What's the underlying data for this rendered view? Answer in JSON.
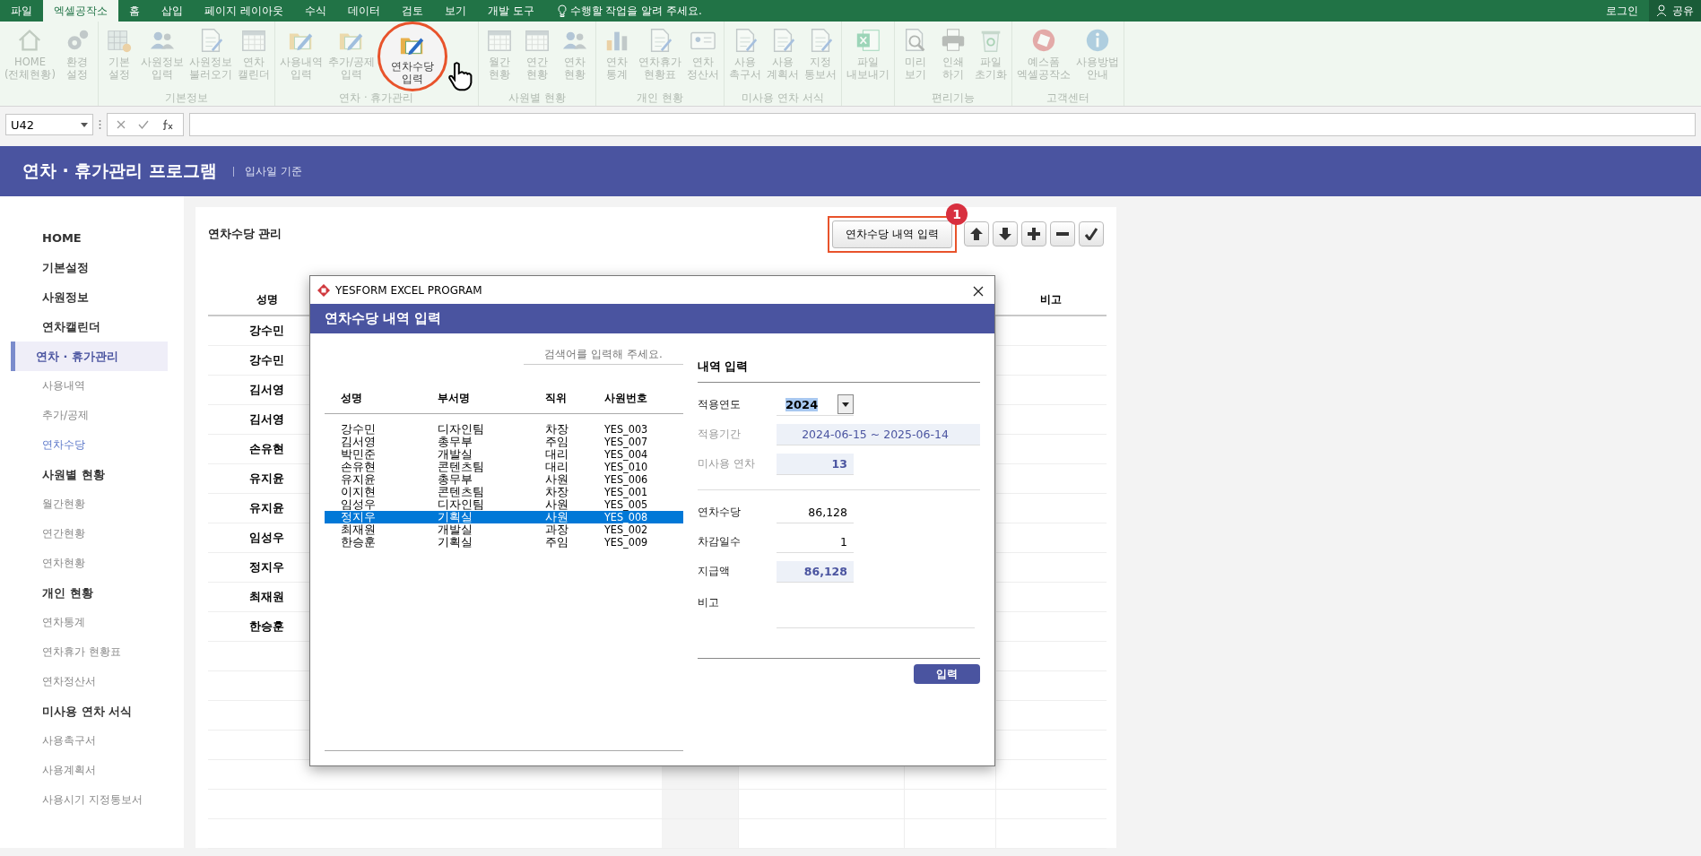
{
  "menu_tabs": [
    {
      "label": "파일",
      "selected": false
    },
    {
      "label": "엑셀공작소",
      "selected": true
    },
    {
      "label": "홈",
      "selected": false
    },
    {
      "label": "삽입",
      "selected": false
    },
    {
      "label": "페이지 레이아웃",
      "selected": false
    },
    {
      "label": "수식",
      "selected": false
    },
    {
      "label": "데이터",
      "selected": false
    },
    {
      "label": "검토",
      "selected": false
    },
    {
      "label": "보기",
      "selected": false
    },
    {
      "label": "개발 도구",
      "selected": false
    }
  ],
  "tell_me": "수행할 작업을 알려 주세요.",
  "login": "로그인",
  "share": "공유",
  "ribbon_groups": [
    {
      "buttons": [
        {
          "label": "HOME\n(전체현황)",
          "disabled": true
        },
        {
          "label": "환경\n설정",
          "disabled": true
        }
      ]
    },
    {
      "label": "기본정보",
      "buttons": [
        {
          "label": "기본\n설정",
          "disabled": true
        },
        {
          "label": "사원정보\n입력",
          "disabled": true
        },
        {
          "label": "사원정보\n불러오기",
          "disabled": true
        },
        {
          "label": "연차\n캘린더",
          "disabled": true
        }
      ]
    },
    {
      "label": "연차 · 휴가관리",
      "buttons": [
        {
          "label": "사용내역\n입력",
          "disabled": true
        },
        {
          "label": "추가/공제\n입력",
          "disabled": true
        },
        {
          "label": "연차수당\n입력",
          "disabled": false
        }
      ]
    },
    {
      "label": "사원별 현황",
      "buttons": [
        {
          "label": "월간\n현황",
          "disabled": true
        },
        {
          "label": "연간\n현황",
          "disabled": true
        },
        {
          "label": "연차\n현황",
          "disabled": true
        }
      ]
    },
    {
      "label": "개인 현황",
      "buttons": [
        {
          "label": "연차\n통계",
          "disabled": true
        },
        {
          "label": "연차휴가\n현황표",
          "disabled": true
        },
        {
          "label": "연차\n정산서",
          "disabled": true
        }
      ]
    },
    {
      "label": "미사용 연차 서식",
      "buttons": [
        {
          "label": "사용\n촉구서",
          "disabled": true
        },
        {
          "label": "사용\n계획서",
          "disabled": true
        },
        {
          "label": "지정\n통보서",
          "disabled": true
        }
      ]
    },
    {
      "buttons": [
        {
          "label": "파일\n내보내기",
          "disabled": true
        }
      ]
    },
    {
      "label": "편리기능",
      "buttons": [
        {
          "label": "미리\n보기",
          "disabled": true
        },
        {
          "label": "인쇄\n하기",
          "disabled": true
        },
        {
          "label": "파일\n초기화",
          "disabled": true
        }
      ]
    },
    {
      "label": "고객센터",
      "buttons": [
        {
          "label": "예스폼\n엑셀공작소",
          "disabled": true
        },
        {
          "label": "사용방법\n안내",
          "disabled": true
        }
      ]
    }
  ],
  "name_box": "U42",
  "app_header": {
    "title": "연차 · 휴가관리 프로그램",
    "subtitle": "입사일 기준"
  },
  "sidebar": [
    {
      "label": "HOME",
      "selected": false
    },
    {
      "label": "기본설정",
      "selected": false
    },
    {
      "label": "사원정보",
      "selected": false
    },
    {
      "label": "연차캘린더",
      "selected": false
    },
    {
      "label": "연차 · 휴가관리",
      "selected": true,
      "children": [
        {
          "label": "사용내역",
          "selected": false
        },
        {
          "label": "추가/공제",
          "selected": false
        },
        {
          "label": "연차수당",
          "selected": true
        }
      ]
    },
    {
      "label": "사원별 현황",
      "selected": false,
      "children": [
        {
          "label": "월간현황",
          "selected": false
        },
        {
          "label": "연간현황",
          "selected": false
        },
        {
          "label": "연차현황",
          "selected": false
        }
      ]
    },
    {
      "label": "개인 현황",
      "selected": false,
      "children": [
        {
          "label": "연차통계",
          "selected": false
        },
        {
          "label": "연차휴가 현황표",
          "selected": false
        },
        {
          "label": "연차정산서",
          "selected": false
        }
      ]
    },
    {
      "label": "미사용 연차 서식",
      "selected": false,
      "children": [
        {
          "label": "사용촉구서",
          "selected": false
        },
        {
          "label": "사용계획서",
          "selected": false
        },
        {
          "label": "사용시기 지정통보서",
          "selected": false
        }
      ]
    }
  ],
  "panel": {
    "title": "연차수당 관리",
    "action_button": "연차수당 내역 입력",
    "step_badge": "1"
  },
  "table": {
    "columns": [
      {
        "header": "성명"
      },
      {
        "header": "비고"
      }
    ],
    "rows": [
      {
        "name": "강수민"
      },
      {
        "name": "강수민"
      },
      {
        "name": "김서영"
      },
      {
        "name": "김서영"
      },
      {
        "name": "손유현"
      },
      {
        "name": "유지윤"
      },
      {
        "name": "유지윤"
      },
      {
        "name": "임성우"
      },
      {
        "name": "정지우"
      },
      {
        "name": "최재원"
      },
      {
        "name": "한승훈"
      }
    ]
  },
  "dialog": {
    "window_title": "YESFORM EXCEL PROGRAM",
    "heading": "연차수당 내역 입력",
    "search": {
      "placeholder": "검색어를 입력해 주세요."
    },
    "list_columns": [
      "성명",
      "부서명",
      "직위",
      "사원번호"
    ],
    "employees": [
      {
        "cells": [
          "강수민",
          "디자인팀",
          "차장",
          "YES_003"
        ],
        "selected": false
      },
      {
        "cells": [
          "김서영",
          "총무부",
          "주임",
          "YES_007"
        ],
        "selected": false
      },
      {
        "cells": [
          "박민준",
          "개발실",
          "대리",
          "YES_004"
        ],
        "selected": false
      },
      {
        "cells": [
          "손유현",
          "콘텐츠팀",
          "대리",
          "YES_010"
        ],
        "selected": false
      },
      {
        "cells": [
          "유지윤",
          "총무부",
          "사원",
          "YES_006"
        ],
        "selected": false
      },
      {
        "cells": [
          "이지현",
          "콘텐츠팀",
          "차장",
          "YES_001"
        ],
        "selected": false
      },
      {
        "cells": [
          "임성우",
          "디자인팀",
          "사원",
          "YES_005"
        ],
        "selected": false
      },
      {
        "cells": [
          "정지우",
          "기획실",
          "사원",
          "YES_008"
        ],
        "selected": true
      },
      {
        "cells": [
          "최재원",
          "개발실",
          "과장",
          "YES_002"
        ],
        "selected": false
      },
      {
        "cells": [
          "한승훈",
          "기획실",
          "주임",
          "YES_009"
        ],
        "selected": false
      }
    ],
    "form_title": "내역 입력",
    "fields": [
      {
        "kind": "select",
        "label": "적용연도",
        "value": "2024"
      },
      {
        "kind": "readonly-wide",
        "label": "적용기간",
        "value": "2024-06-15 ~ 2025-06-14"
      },
      {
        "kind": "readonly",
        "label": "미사용 연차",
        "value": "13"
      },
      {
        "kind": "divider"
      },
      {
        "kind": "input",
        "label": "연차수당",
        "value": "86,128"
      },
      {
        "kind": "input",
        "label": "차감일수",
        "value": "1"
      },
      {
        "kind": "total",
        "label": "지급액",
        "value": "86,128"
      },
      {
        "kind": "memo",
        "label": "비고"
      }
    ],
    "submit": "입력"
  }
}
